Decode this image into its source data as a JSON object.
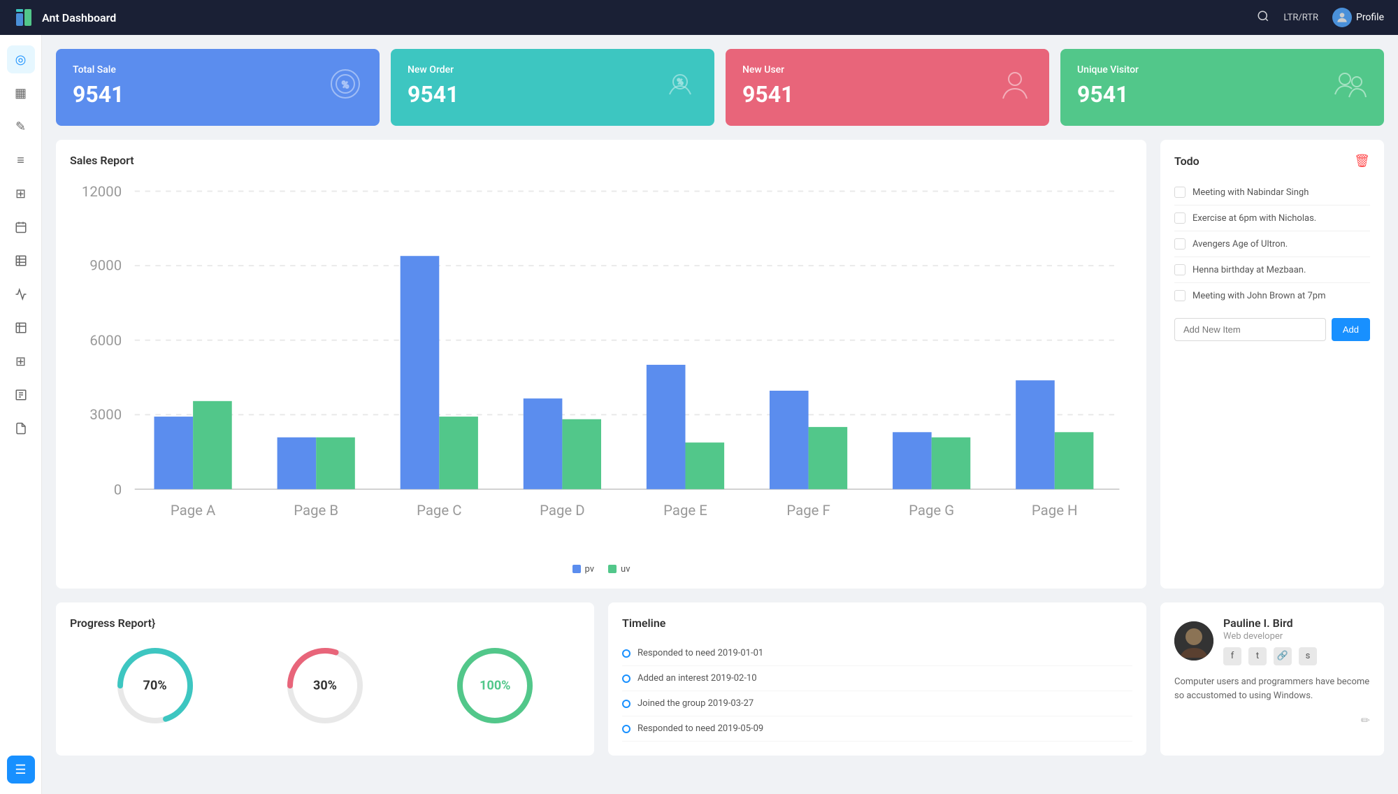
{
  "app": {
    "title": "Ant Dashboard"
  },
  "topnav": {
    "search_label": "Search",
    "ltr_label": "LTR/RTR",
    "profile_label": "Profile"
  },
  "sidebar": {
    "items": [
      {
        "name": "dashboard",
        "icon": "◎"
      },
      {
        "name": "layout",
        "icon": "▦"
      },
      {
        "name": "edit",
        "icon": "✎"
      },
      {
        "name": "menu",
        "icon": "≡"
      },
      {
        "name": "grid",
        "icon": "⊞"
      },
      {
        "name": "calendar",
        "icon": "▦"
      },
      {
        "name": "table",
        "icon": "▤"
      },
      {
        "name": "chart",
        "icon": "↗"
      },
      {
        "name": "report",
        "icon": "▤"
      },
      {
        "name": "grid2",
        "icon": "⊞"
      },
      {
        "name": "document",
        "icon": "▤"
      },
      {
        "name": "file",
        "icon": "▭"
      },
      {
        "name": "list-active",
        "icon": "☰"
      }
    ]
  },
  "stats": [
    {
      "label": "Total Sale",
      "value": "9541",
      "color": "blue"
    },
    {
      "label": "New Order",
      "value": "9541",
      "color": "teal"
    },
    {
      "label": "New User",
      "value": "9541",
      "color": "pink"
    },
    {
      "label": "Unique Visitor",
      "value": "9541",
      "color": "green"
    }
  ],
  "sales_report": {
    "title": "Sales Report",
    "legend_pv": "pv",
    "legend_uv": "uv",
    "data": [
      {
        "page": "Page A",
        "pv": 2800,
        "uv": 3400
      },
      {
        "page": "Page B",
        "pv": 2000,
        "uv": 2000
      },
      {
        "page": "Page C",
        "pv": 9000,
        "uv": 2800
      },
      {
        "page": "Page D",
        "pv": 3500,
        "uv": 2700
      },
      {
        "page": "Page E",
        "pv": 4800,
        "uv": 1800
      },
      {
        "page": "Page F",
        "pv": 3800,
        "uv": 2400
      },
      {
        "page": "Page G",
        "pv": 2200,
        "uv": 2000
      },
      {
        "page": "Page H",
        "pv": 4200,
        "uv": 2200
      }
    ],
    "y_labels": [
      "0",
      "3000",
      "6000",
      "9000",
      "12000"
    ]
  },
  "todo": {
    "title": "Todo",
    "items": [
      {
        "text": "Meeting with Nabindar Singh"
      },
      {
        "text": "Exercise at 6pm with Nicholas."
      },
      {
        "text": "Avengers Age of Ultron."
      },
      {
        "text": "Henna birthday at Mezbaan."
      },
      {
        "text": "Meeting with John Brown at 7pm"
      }
    ],
    "add_placeholder": "Add New Item",
    "add_button": "Add"
  },
  "progress_report": {
    "title": "Progress Report}",
    "circles": [
      {
        "value": 70,
        "label": "70%",
        "color": "#3dc6c1"
      },
      {
        "value": 30,
        "label": "30%",
        "color": "#e8657a"
      },
      {
        "value": 100,
        "label": "100%",
        "color": "#52c78a"
      }
    ]
  },
  "timeline": {
    "title": "Timeline",
    "items": [
      {
        "text": "Responded to need 2019-01-01"
      },
      {
        "text": "Added an interest 2019-02-10"
      },
      {
        "text": "Joined the group 2019-03-27"
      },
      {
        "text": "Responded to need 2019-05-09"
      }
    ]
  },
  "profile": {
    "name": "Pauline I. Bird",
    "role": "Web developer",
    "bio": "Computer users and programmers have become so accustomed to using Windows.",
    "social": [
      "f",
      "t",
      "🔗",
      "s"
    ]
  }
}
